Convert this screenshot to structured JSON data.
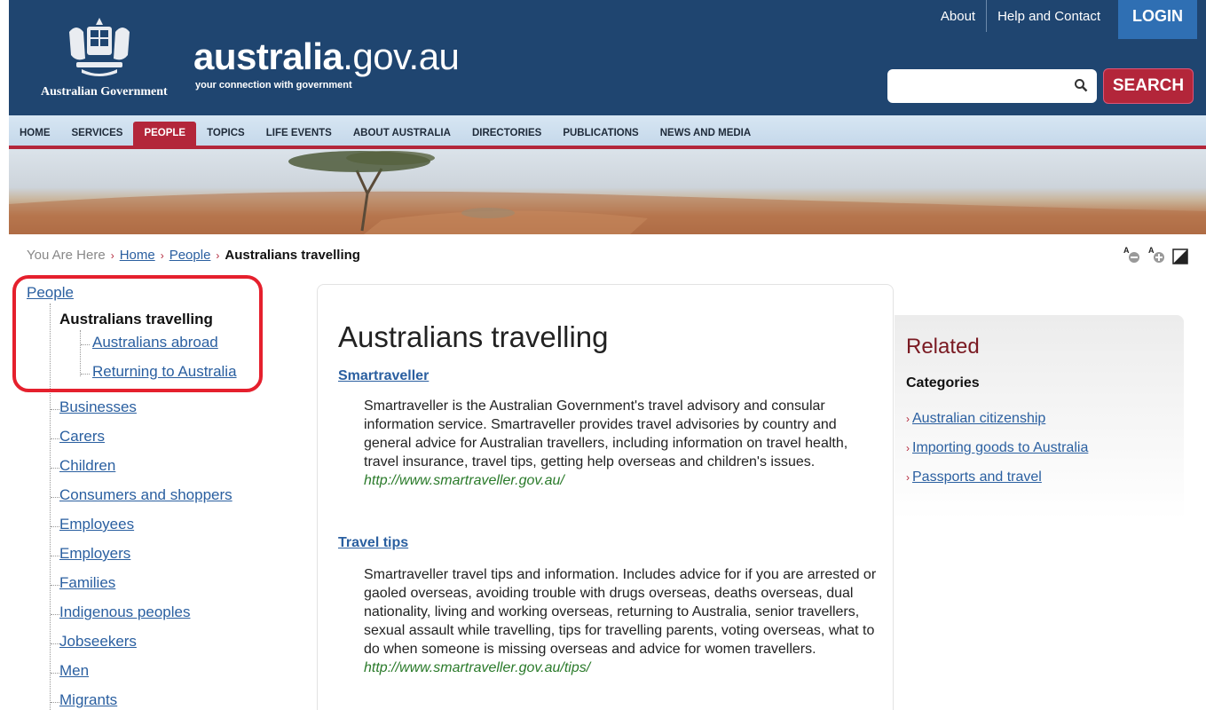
{
  "header": {
    "gov_name": "Australian Government",
    "brand_bold": "australia",
    "brand_rest": ".gov.au",
    "brand_tagline": "your connection with government",
    "top_links": [
      "About",
      "Help and Contact"
    ],
    "login_label": "LOGIN",
    "search_placeholder": "",
    "search_label": "SEARCH"
  },
  "nav": {
    "items": [
      "HOME",
      "SERVICES",
      "PEOPLE",
      "TOPICS",
      "LIFE EVENTS",
      "ABOUT AUSTRALIA",
      "DIRECTORIES",
      "PUBLICATIONS",
      "NEWS AND MEDIA"
    ],
    "active": "PEOPLE"
  },
  "breadcrumb": {
    "prefix": "You Are Here",
    "links": [
      "Home",
      "People"
    ],
    "current": "Australians travelling"
  },
  "leftnav": {
    "root": "People",
    "active": "Australians travelling",
    "subitems": [
      "Australians abroad",
      "Returning to Australia"
    ],
    "items": [
      "Businesses",
      "Carers",
      "Children",
      "Consumers and shoppers",
      "Employees",
      "Employers",
      "Families",
      "Indigenous peoples",
      "Jobseekers",
      "Men",
      "Migrants"
    ]
  },
  "main": {
    "title": "Australians travelling",
    "entries": [
      {
        "title": "Smartraveller",
        "body": "Smartraveller is the Australian Government's travel advisory and consular information service. Smartraveller provides travel advisories by country and general advice for Australian travellers, including information on travel health, travel insurance, travel tips, getting help overseas and children's issues.",
        "url": "http://www.smartraveller.gov.au/"
      },
      {
        "title": "Travel tips",
        "body": "Smartraveller travel tips and information. Includes advice for if you are arrested or gaoled overseas, avoiding trouble with drugs overseas, deaths overseas, dual nationality, living and working overseas, returning to Australia, senior travellers, sexual assault while travelling, tips for travelling parents, voting overseas, what to do when someone is missing overseas and advice for women travellers.",
        "url": "http://www.smartraveller.gov.au/tips/"
      }
    ]
  },
  "related": {
    "title": "Related",
    "subtitle": "Categories",
    "items": [
      "Australian citizenship",
      "Importing goods to Australia",
      "Passports and travel"
    ]
  },
  "colors": {
    "header_bg": "#1f4570",
    "accent_red": "#b3263a",
    "link_blue": "#2a5fa0",
    "url_green": "#2a7a2a",
    "highlight_red": "#e5202d"
  }
}
